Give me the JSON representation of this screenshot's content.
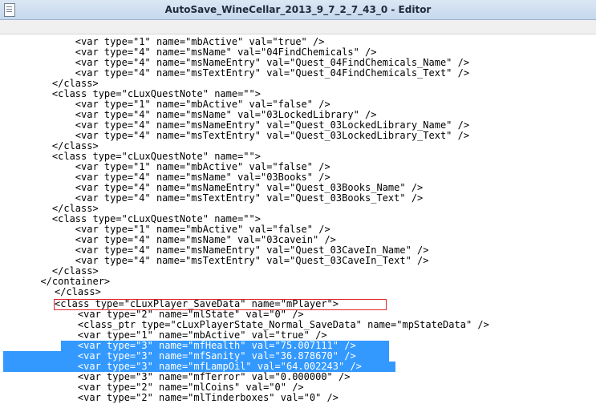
{
  "window": {
    "title": "AutoSave_WineCellar_2013_9_7_2_7_43_0 - Editor",
    "icon": "notepad-icon"
  },
  "editor": {
    "lines": [
      "        <var type=\"1\" name=\"mbActive\" val=\"true\" />",
      "        <var type=\"4\" name=\"msName\" val=\"04FindChemicals\" />",
      "        <var type=\"4\" name=\"msNameEntry\" val=\"Quest_04FindChemicals_Name\" />",
      "        <var type=\"4\" name=\"msTextEntry\" val=\"Quest_04FindChemicals_Text\" />",
      "    </class>",
      "    <class type=\"cLuxQuestNote\" name=\"\">",
      "        <var type=\"1\" name=\"mbActive\" val=\"false\" />",
      "        <var type=\"4\" name=\"msName\" val=\"03LockedLibrary\" />",
      "        <var type=\"4\" name=\"msNameEntry\" val=\"Quest_03LockedLibrary_Name\" />",
      "        <var type=\"4\" name=\"msTextEntry\" val=\"Quest_03LockedLibrary_Text\" />",
      "    </class>",
      "    <class type=\"cLuxQuestNote\" name=\"\">",
      "        <var type=\"1\" name=\"mbActive\" val=\"false\" />",
      "        <var type=\"4\" name=\"msName\" val=\"03Books\" />",
      "        <var type=\"4\" name=\"msNameEntry\" val=\"Quest_03Books_Name\" />",
      "        <var type=\"4\" name=\"msTextEntry\" val=\"Quest_03Books_Text\" />",
      "    </class>",
      "    <class type=\"cLuxQuestNote\" name=\"\">",
      "        <var type=\"1\" name=\"mbActive\" val=\"false\" />",
      "        <var type=\"4\" name=\"msName\" val=\"03cavein\" />",
      "        <var type=\"4\" name=\"msNameEntry\" val=\"Quest_03CaveIn_Name\" />",
      "        <var type=\"4\" name=\"msTextEntry\" val=\"Quest_03CaveIn_Text\" />",
      "    </class>",
      "  </container>",
      "</class>",
      "<class type=\"cLuxPlayer_SaveData\" name=\"mPlayer\">",
      "    <var type=\"2\" name=\"mlState\" val=\"0\" />",
      "    <class_ptr type=\"cLuxPlayerState_Normal_SaveData\" name=\"mpStateData\" />",
      "    <var type=\"1\" name=\"mbActive\" val=\"true\" />",
      "    <var type=\"3\" name=\"mfHealth\" val=\"75.007111\" />",
      "    <var type=\"3\" name=\"mfSanity\" val=\"36.878670\" />",
      "    <var type=\"3\" name=\"mfLampOil\" val=\"64.002243\" />",
      "    <var type=\"3\" name=\"mfTerror\" val=\"0.000000\" />",
      "    <var type=\"2\" name=\"mlCoins\" val=\"0\" />",
      "    <var type=\"2\" name=\"mlTinderboxes\" val=\"0\" />"
    ]
  },
  "colors": {
    "selection": "#3399ff",
    "highlight_box": "#e0262c"
  }
}
